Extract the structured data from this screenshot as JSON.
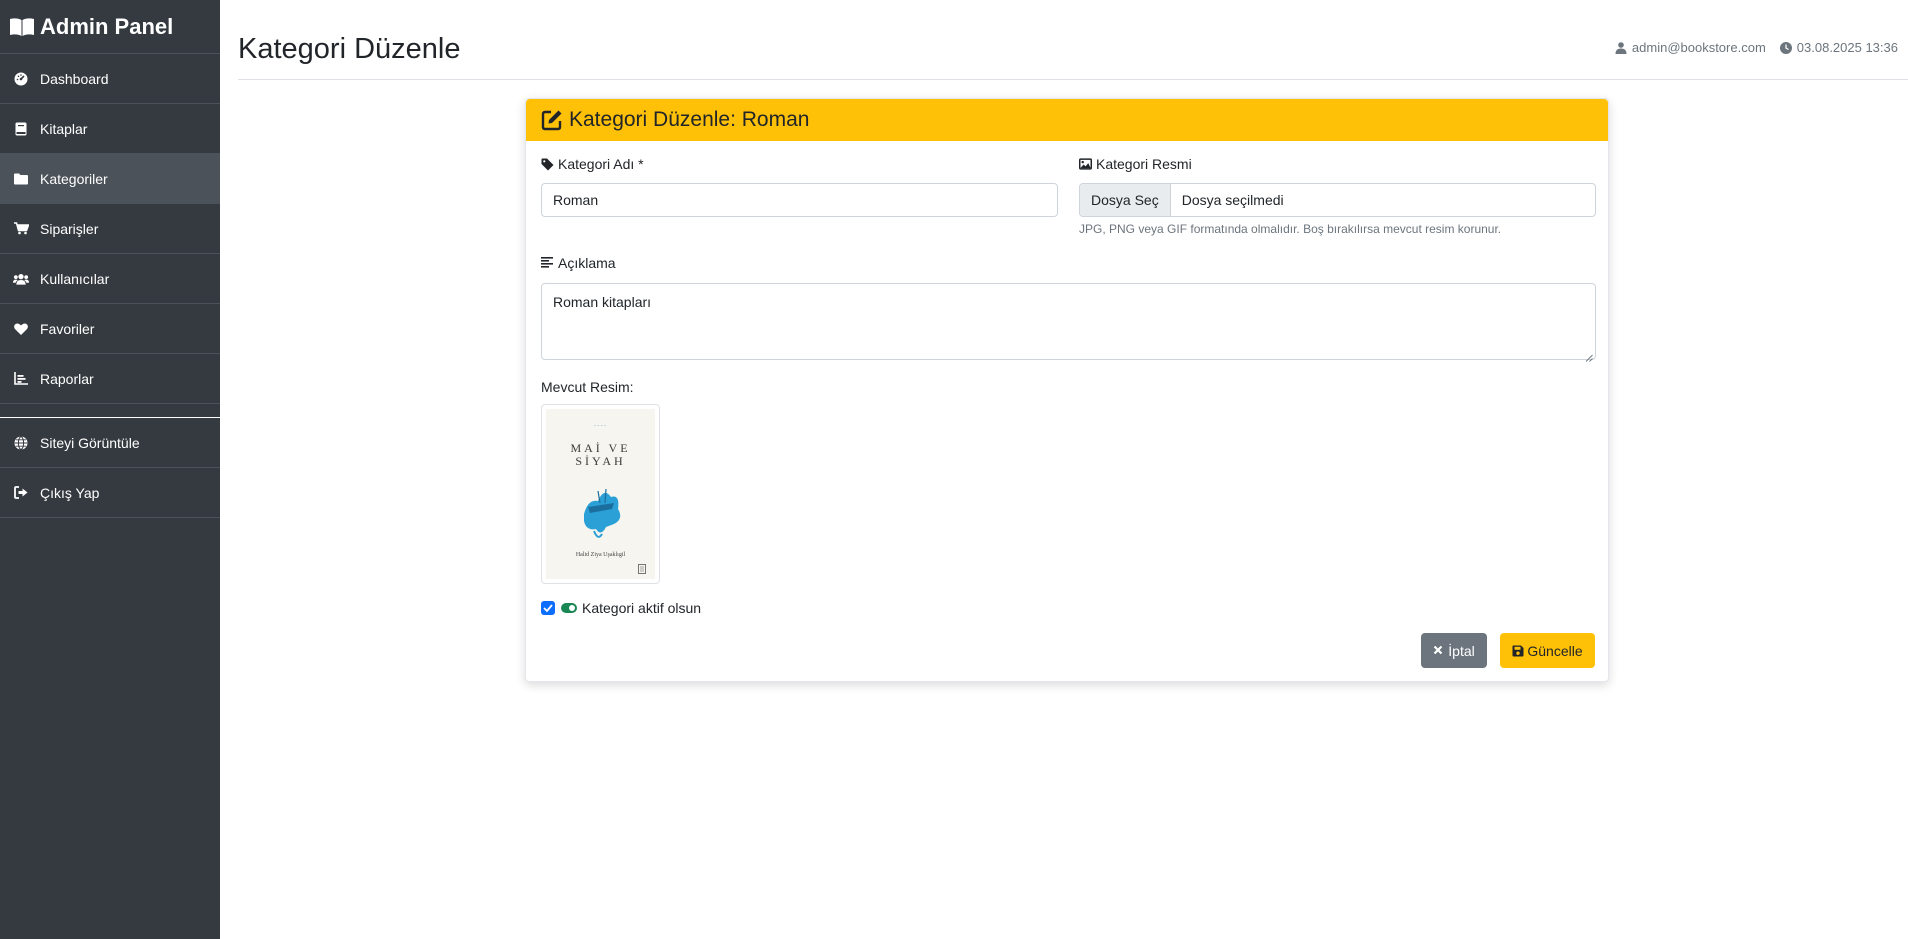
{
  "sidebar": {
    "brand": "Admin Panel",
    "items": [
      {
        "label": "Dashboard",
        "icon": "gauge-icon"
      },
      {
        "label": "Kitaplar",
        "icon": "book-icon"
      },
      {
        "label": "Kategoriler",
        "icon": "folder-icon",
        "active": true
      },
      {
        "label": "Siparişler",
        "icon": "cart-icon"
      },
      {
        "label": "Kullanıcılar",
        "icon": "users-icon"
      },
      {
        "label": "Favoriler",
        "icon": "heart-icon"
      },
      {
        "label": "Raporlar",
        "icon": "chart-icon"
      }
    ],
    "secondary": [
      {
        "label": "Siteyi Görüntüle",
        "icon": "globe-icon"
      },
      {
        "label": "Çıkış Yap",
        "icon": "logout-icon"
      }
    ]
  },
  "header": {
    "title": "Kategori Düzenle",
    "user": "admin@bookstore.com",
    "datetime": "03.08.2025 13:36"
  },
  "card": {
    "title": "Kategori Düzenle: Roman",
    "name_label": "Kategori Adı *",
    "name_value": "Roman",
    "image_label": "Kategori Resmi",
    "file_button": "Dosya Seç",
    "file_status": "Dosya seçilmedi",
    "image_help": "JPG, PNG veya GIF formatında olmalıdır. Boş bırakılırsa mevcut resim korunur.",
    "description_label": "Açıklama",
    "description_value": "Roman kitapları",
    "current_image_label": "Mevcut Resim:",
    "cover": {
      "title_line1": "MAİ VE",
      "title_line2": "SİYAH",
      "author": "Halid Ziya Uşaklıgil"
    },
    "active_label": "Kategori aktif olsun",
    "active_checked": true,
    "cancel_label": "İptal",
    "save_label": "Güncelle"
  },
  "colors": {
    "sidebar_bg": "#343a40",
    "warning": "#ffc107",
    "secondary": "#6c757d",
    "primary": "#0d6efd",
    "success": "#198754"
  }
}
